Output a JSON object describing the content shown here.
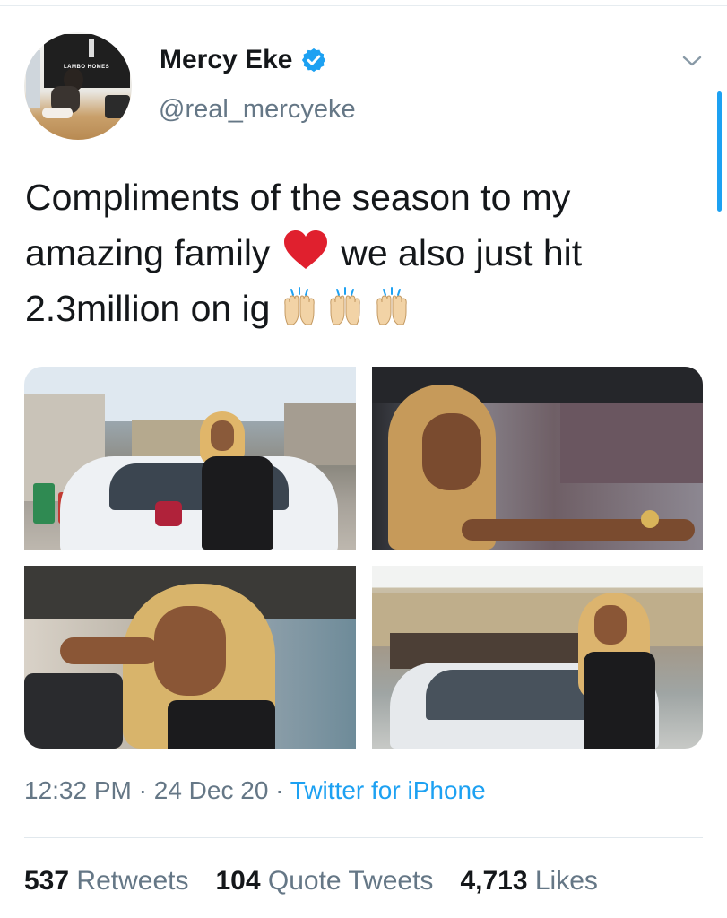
{
  "author": {
    "display_name": "Mercy Eke",
    "handle": "@real_mercyeke",
    "verified": true,
    "avatar_sign_text": "LAMBO HOMES"
  },
  "tweet": {
    "text_part1": "Compliments of the season to my amazing family",
    "text_part2": "we also just hit 2.3million on ig",
    "emojis": [
      "red-heart",
      "raising-hands",
      "raising-hands",
      "raising-hands"
    ]
  },
  "media": {
    "count": 4
  },
  "meta": {
    "time": "12:32 PM",
    "separator": "·",
    "date": "24 Dec 20",
    "source": "Twitter for iPhone"
  },
  "stats": {
    "retweets_count": "537",
    "retweets_label": "Retweets",
    "quotes_count": "104",
    "quotes_label": "Quote Tweets",
    "likes_count": "4,713",
    "likes_label": "Likes"
  },
  "colors": {
    "link": "#1da1f2",
    "secondary_text": "#657786",
    "primary_text": "#14171a",
    "verified_badge": "#1da1f2",
    "heart": "#e0202e"
  }
}
